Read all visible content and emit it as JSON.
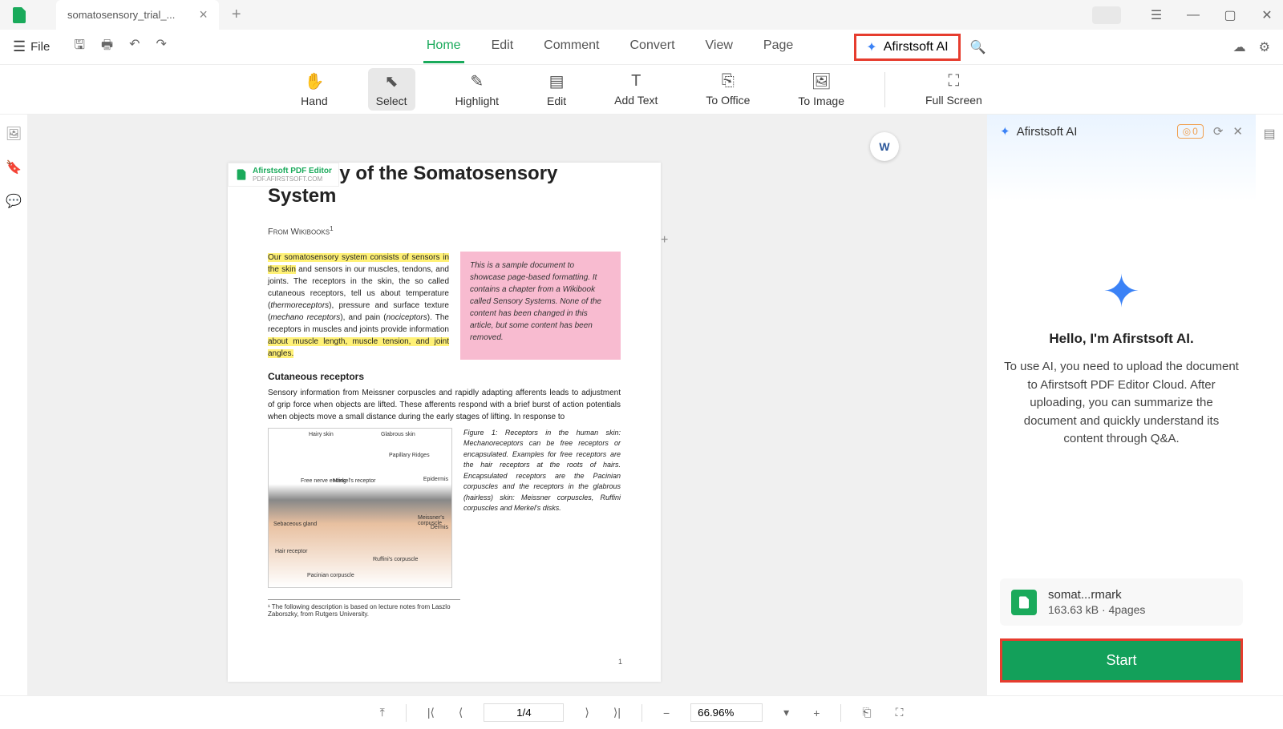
{
  "tab": {
    "title": "somatosensory_trial_...",
    "close": "×",
    "add": "+"
  },
  "menu": {
    "file": "File"
  },
  "tabs": {
    "home": "Home",
    "edit": "Edit",
    "comment": "Comment",
    "convert": "Convert",
    "view": "View",
    "page": "Page",
    "ai": "Afirstsoft AI"
  },
  "tools": {
    "hand": "Hand",
    "select": "Select",
    "highlight": "Highlight",
    "edit": "Edit",
    "addtext": "Add Text",
    "tooffice": "To Office",
    "toimage": "To Image",
    "fullscreen": "Full Screen"
  },
  "doc": {
    "watermark": "Afirstsoft PDF Editor",
    "watermark_url": "PDF.AFIRSTSOFT.COM",
    "title": "Anatomy of the Somatosensory System",
    "source": "From Wikibooks",
    "hl1": "Our somatosensory system consists of sensors in the skin",
    "body1a": " and sensors in our muscles, tendons, and joints. The receptors in the skin, the so called cutaneous receptors, tell us about temperature (",
    "body1b": "thermoreceptors",
    "body1c": "), pressure and surface texture (",
    "body1d": "mechano receptors",
    "body1e": "), and pain (",
    "body1f": "nociceptors",
    "body1g": "). The receptors in muscles and joints provide information ",
    "hl2": "about muscle length, muscle tension, and joint angles.",
    "callout": "This is a sample document to showcase page-based formatting. It contains a chapter from a Wikibook called Sensory Systems. None of the content has been changed in this article, but some content has been removed.",
    "subhead": "Cutaneous receptors",
    "body2": "Sensory information from Meissner corpuscles and rapidly adapting afferents leads to adjustment of grip force when objects are lifted. These afferents respond with a brief burst of action potentials when objects move a small distance during the early stages of lifting. In response to",
    "figcap": "Figure 1:  Receptors in the human skin: Mechanoreceptors can be free receptors or encapsulated. Examples for free receptors are the hair receptors at the roots of hairs. Encapsulated receptors are the Pacinian corpuscles and the receptors in the glabrous (hairless) skin: Meissner corpuscles, Ruffini corpuscles and Merkel's disks.",
    "footnote": "¹ The following description is based on lecture notes from Laszlo Zaborszky, from Rutgers University.",
    "pagenum": "1",
    "labels": {
      "hairy": "Hairy skin",
      "glabrous": "Glabrous skin",
      "epidermis": "Epidermis",
      "dermis": "Dermis",
      "papillary": "Papillary Ridges",
      "freenerve": "Free nerve ending",
      "merkel": "Merkel's receptor",
      "meissner": "Meissner's corpuscle",
      "hair": "Hair receptor",
      "pacinian": "Pacinian corpuscle",
      "ruffini": "Ruffini's corpuscle",
      "sebaceous": "Sebaceous gland"
    }
  },
  "ai": {
    "title": "Afirstsoft AI",
    "tokens": "0",
    "hello": "Hello, I'm Afirstsoft AI.",
    "desc": "To use AI, you need to upload the document to Afirstsoft PDF Editor Cloud. After uploading, you can summarize the document and quickly understand its content through Q&A.",
    "file_name": "somat...rmark",
    "file_meta": "163.63 kB · 4pages",
    "start": "Start"
  },
  "status": {
    "page": "1/4",
    "zoom": "66.96%"
  }
}
